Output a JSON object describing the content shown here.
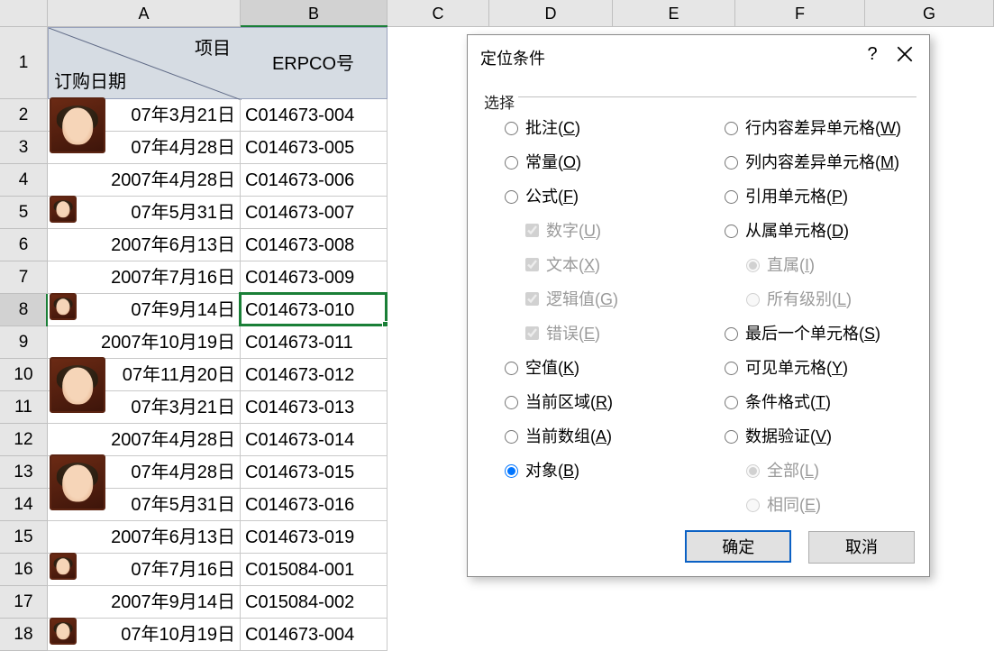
{
  "columns": [
    "A",
    "B",
    "C",
    "D",
    "E",
    "F",
    "G"
  ],
  "selected_column": "B",
  "selected_row": 8,
  "header": {
    "diag_top": "项目",
    "diag_bottom": "订购日期",
    "b_header": "ERPCO号"
  },
  "rows": [
    {
      "n": 2,
      "date": "07年3月21日",
      "code": "C014673-004",
      "avatar": true,
      "prefix_hidden": true
    },
    {
      "n": 3,
      "date": "07年4月28日",
      "code": "C014673-005",
      "avatar": true,
      "prefix_hidden": true
    },
    {
      "n": 4,
      "date": "2007年4月28日",
      "code": "C014673-006",
      "avatar": false,
      "prefix_hidden": false
    },
    {
      "n": 5,
      "date": "07年5月31日",
      "code": "C014673-007",
      "avatar": true,
      "prefix_hidden": true
    },
    {
      "n": 6,
      "date": "2007年6月13日",
      "code": "C014673-008",
      "avatar": false,
      "prefix_hidden": false
    },
    {
      "n": 7,
      "date": "2007年7月16日",
      "code": "C014673-009",
      "avatar": false,
      "prefix_hidden": false
    },
    {
      "n": 8,
      "date": "07年9月14日",
      "code": "C014673-010",
      "avatar": true,
      "prefix_hidden": true
    },
    {
      "n": 9,
      "date": "2007年10月19日",
      "code": "C014673-011",
      "avatar": false,
      "prefix_hidden": false
    },
    {
      "n": 10,
      "date": "07年11月20日",
      "code": "C014673-012",
      "avatar": true,
      "prefix_hidden": true
    },
    {
      "n": 11,
      "date": "07年3月21日",
      "code": "C014673-013",
      "avatar": true,
      "prefix_hidden": true
    },
    {
      "n": 12,
      "date": "2007年4月28日",
      "code": "C014673-014",
      "avatar": false,
      "prefix_hidden": false
    },
    {
      "n": 13,
      "date": "07年4月28日",
      "code": "C014673-015",
      "avatar": true,
      "prefix_hidden": true
    },
    {
      "n": 14,
      "date": "07年5月31日",
      "code": "C014673-016",
      "avatar": true,
      "prefix_hidden": true
    },
    {
      "n": 15,
      "date": "2007年6月13日",
      "code": "C014673-019",
      "avatar": false,
      "prefix_hidden": false
    },
    {
      "n": 16,
      "date": "07年7月16日",
      "code": "C015084-001",
      "avatar": true,
      "prefix_hidden": true
    },
    {
      "n": 17,
      "date": "2007年9月14日",
      "code": "C015084-002",
      "avatar": false,
      "prefix_hidden": false
    },
    {
      "n": 18,
      "date": "07年10月19日",
      "code": "C014673-004",
      "avatar": true,
      "prefix_hidden": true
    }
  ],
  "dialog": {
    "title": "定位条件",
    "section_label": "选择",
    "left": [
      {
        "key": "comments",
        "text": "批注",
        "accel": "C",
        "type": "radio"
      },
      {
        "key": "constants",
        "text": "常量",
        "accel": "O",
        "type": "radio"
      },
      {
        "key": "formulas",
        "text": "公式",
        "accel": "F",
        "type": "radio"
      },
      {
        "key": "numbers",
        "text": "数字",
        "accel": "U",
        "type": "checkbox",
        "indent": true,
        "disabled": true,
        "checked": true
      },
      {
        "key": "text",
        "text": "文本",
        "accel": "X",
        "type": "checkbox",
        "indent": true,
        "disabled": true,
        "checked": true
      },
      {
        "key": "logicals",
        "text": "逻辑值",
        "accel": "G",
        "type": "checkbox",
        "indent": true,
        "disabled": true,
        "checked": true
      },
      {
        "key": "errors",
        "text": "错误",
        "accel": "E",
        "type": "checkbox",
        "indent": true,
        "disabled": true,
        "checked": true
      },
      {
        "key": "blanks",
        "text": "空值",
        "accel": "K",
        "type": "radio"
      },
      {
        "key": "current_region",
        "text": "当前区域",
        "accel": "R",
        "type": "radio"
      },
      {
        "key": "current_array",
        "text": "当前数组",
        "accel": "A",
        "type": "radio"
      },
      {
        "key": "objects",
        "text": "对象",
        "accel": "B",
        "type": "radio",
        "checked": true
      }
    ],
    "right": [
      {
        "key": "row_diff",
        "text": "行内容差异单元格",
        "accel": "W",
        "type": "radio"
      },
      {
        "key": "col_diff",
        "text": "列内容差异单元格",
        "accel": "M",
        "type": "radio"
      },
      {
        "key": "precedents",
        "text": "引用单元格",
        "accel": "P",
        "type": "radio"
      },
      {
        "key": "dependents",
        "text": "从属单元格",
        "accel": "D",
        "type": "radio"
      },
      {
        "key": "direct",
        "text": "直属",
        "accel": "I",
        "type": "radio",
        "indent": true,
        "disabled": true,
        "checked": true
      },
      {
        "key": "all_levels",
        "text": "所有级别",
        "accel": "L",
        "type": "radio",
        "indent": true,
        "disabled": true
      },
      {
        "key": "last_cell",
        "text": "最后一个单元格",
        "accel": "S",
        "type": "radio"
      },
      {
        "key": "visible",
        "text": "可见单元格",
        "accel": "Y",
        "type": "radio"
      },
      {
        "key": "cond_format",
        "text": "条件格式",
        "accel": "T",
        "type": "radio"
      },
      {
        "key": "data_val",
        "text": "数据验证",
        "accel": "V",
        "type": "radio"
      },
      {
        "key": "all",
        "text": "全部",
        "accel": "L",
        "type": "radio",
        "indent": true,
        "disabled": true,
        "checked": true
      },
      {
        "key": "same",
        "text": "相同",
        "accel": "E",
        "type": "radio",
        "indent": true,
        "disabled": true
      }
    ],
    "ok": "确定",
    "cancel": "取消"
  }
}
